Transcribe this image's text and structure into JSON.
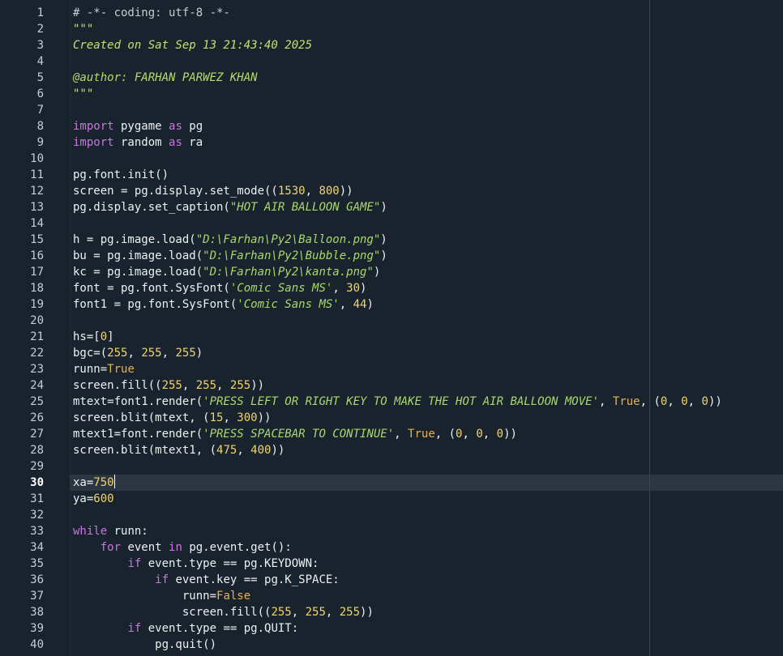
{
  "editor": {
    "current_line": 30,
    "lines": [
      [
        [
          "cm",
          "# -*- coding: utf-8 -*-"
        ]
      ],
      [
        [
          "dc",
          "\"\"\""
        ]
      ],
      [
        [
          "dc",
          "Created on Sat Sep 13 21:43:40 2025"
        ]
      ],
      [],
      [
        [
          "d",
          "@author: FARHAN PARWEZ KHAN"
        ]
      ],
      [
        [
          "dc",
          "\"\"\""
        ]
      ],
      [],
      [
        [
          "k",
          "import"
        ],
        [
          "t",
          " pygame "
        ],
        [
          "k",
          "as"
        ],
        [
          "t",
          " pg"
        ]
      ],
      [
        [
          "k",
          "import"
        ],
        [
          "t",
          " random "
        ],
        [
          "k",
          "as"
        ],
        [
          "t",
          " ra"
        ]
      ],
      [],
      [
        [
          "t",
          "pg.font.init()"
        ]
      ],
      [
        [
          "t",
          "screen = pg.display.set_mode(("
        ],
        [
          "n",
          "1530"
        ],
        [
          "t",
          ", "
        ],
        [
          "n",
          "800"
        ],
        [
          "t",
          "))"
        ]
      ],
      [
        [
          "t",
          "pg.display.set_caption("
        ],
        [
          "s",
          "\"HOT AIR BALLOON GAME\""
        ],
        [
          "t",
          ")"
        ]
      ],
      [],
      [
        [
          "t",
          "h = pg.image.load("
        ],
        [
          "s",
          "\"D:\\Farhan\\Py2\\Balloon.png\""
        ],
        [
          "t",
          ")"
        ]
      ],
      [
        [
          "t",
          "bu = pg.image.load("
        ],
        [
          "s",
          "\"D:\\Farhan\\Py2\\Bubble.png\""
        ],
        [
          "t",
          ")"
        ]
      ],
      [
        [
          "t",
          "kc = pg.image.load("
        ],
        [
          "s",
          "\"D:\\Farhan\\Py2\\kanta.png\""
        ],
        [
          "t",
          ")"
        ]
      ],
      [
        [
          "t",
          "font = pg.font.SysFont("
        ],
        [
          "s",
          "'Comic Sans MS'"
        ],
        [
          "t",
          ", "
        ],
        [
          "n",
          "30"
        ],
        [
          "t",
          ")"
        ]
      ],
      [
        [
          "t",
          "font1 = pg.font.SysFont("
        ],
        [
          "s",
          "'Comic Sans MS'"
        ],
        [
          "t",
          ", "
        ],
        [
          "n",
          "44"
        ],
        [
          "t",
          ")"
        ]
      ],
      [],
      [
        [
          "t",
          "hs=["
        ],
        [
          "n",
          "0"
        ],
        [
          "t",
          "]"
        ]
      ],
      [
        [
          "t",
          "bgc=("
        ],
        [
          "n",
          "255"
        ],
        [
          "t",
          ", "
        ],
        [
          "n",
          "255"
        ],
        [
          "t",
          ", "
        ],
        [
          "n",
          "255"
        ],
        [
          "t",
          ")"
        ]
      ],
      [
        [
          "t",
          "runn="
        ],
        [
          "c",
          "True"
        ]
      ],
      [
        [
          "t",
          "screen.fill(("
        ],
        [
          "n",
          "255"
        ],
        [
          "t",
          ", "
        ],
        [
          "n",
          "255"
        ],
        [
          "t",
          ", "
        ],
        [
          "n",
          "255"
        ],
        [
          "t",
          "))"
        ]
      ],
      [
        [
          "t",
          "mtext=font1.render("
        ],
        [
          "s",
          "'PRESS LEFT OR RIGHT KEY TO MAKE THE HOT AIR BALLOON MOVE'"
        ],
        [
          "t",
          ", "
        ],
        [
          "c",
          "True"
        ],
        [
          "t",
          ", ("
        ],
        [
          "n",
          "0"
        ],
        [
          "t",
          ", "
        ],
        [
          "n",
          "0"
        ],
        [
          "t",
          ", "
        ],
        [
          "n",
          "0"
        ],
        [
          "t",
          "))"
        ]
      ],
      [
        [
          "t",
          "screen.blit(mtext, ("
        ],
        [
          "n",
          "15"
        ],
        [
          "t",
          ", "
        ],
        [
          "n",
          "300"
        ],
        [
          "t",
          "))"
        ]
      ],
      [
        [
          "t",
          "mtext1=font.render("
        ],
        [
          "s",
          "'PRESS SPACEBAR TO CONTINUE'"
        ],
        [
          "t",
          ", "
        ],
        [
          "c",
          "True"
        ],
        [
          "t",
          ", ("
        ],
        [
          "n",
          "0"
        ],
        [
          "t",
          ", "
        ],
        [
          "n",
          "0"
        ],
        [
          "t",
          ", "
        ],
        [
          "n",
          "0"
        ],
        [
          "t",
          "))"
        ]
      ],
      [
        [
          "t",
          "screen.blit(mtext1, ("
        ],
        [
          "n",
          "475"
        ],
        [
          "t",
          ", "
        ],
        [
          "n",
          "400"
        ],
        [
          "t",
          "))"
        ]
      ],
      [],
      [
        [
          "t",
          "xa="
        ],
        [
          "n",
          "750"
        ]
      ],
      [
        [
          "t",
          "ya="
        ],
        [
          "n",
          "600"
        ]
      ],
      [],
      [
        [
          "k",
          "while"
        ],
        [
          "t",
          " runn:"
        ]
      ],
      [
        [
          "t",
          "    "
        ],
        [
          "k",
          "for"
        ],
        [
          "t",
          " event "
        ],
        [
          "k",
          "in"
        ],
        [
          "t",
          " pg.event.get():"
        ]
      ],
      [
        [
          "t",
          "        "
        ],
        [
          "k",
          "if"
        ],
        [
          "t",
          " event.type == pg.KEYDOWN:"
        ]
      ],
      [
        [
          "t",
          "            "
        ],
        [
          "k",
          "if"
        ],
        [
          "t",
          " event.key == pg.K_SPACE:"
        ]
      ],
      [
        [
          "t",
          "                runn="
        ],
        [
          "c",
          "False"
        ]
      ],
      [
        [
          "t",
          "                screen.fill(("
        ],
        [
          "n",
          "255"
        ],
        [
          "t",
          ", "
        ],
        [
          "n",
          "255"
        ],
        [
          "t",
          ", "
        ],
        [
          "n",
          "255"
        ],
        [
          "t",
          "))"
        ]
      ],
      [
        [
          "t",
          "        "
        ],
        [
          "k",
          "if"
        ],
        [
          "t",
          " event.type == pg.QUIT:"
        ]
      ],
      [
        [
          "t",
          "            pg.quit()"
        ]
      ]
    ]
  }
}
